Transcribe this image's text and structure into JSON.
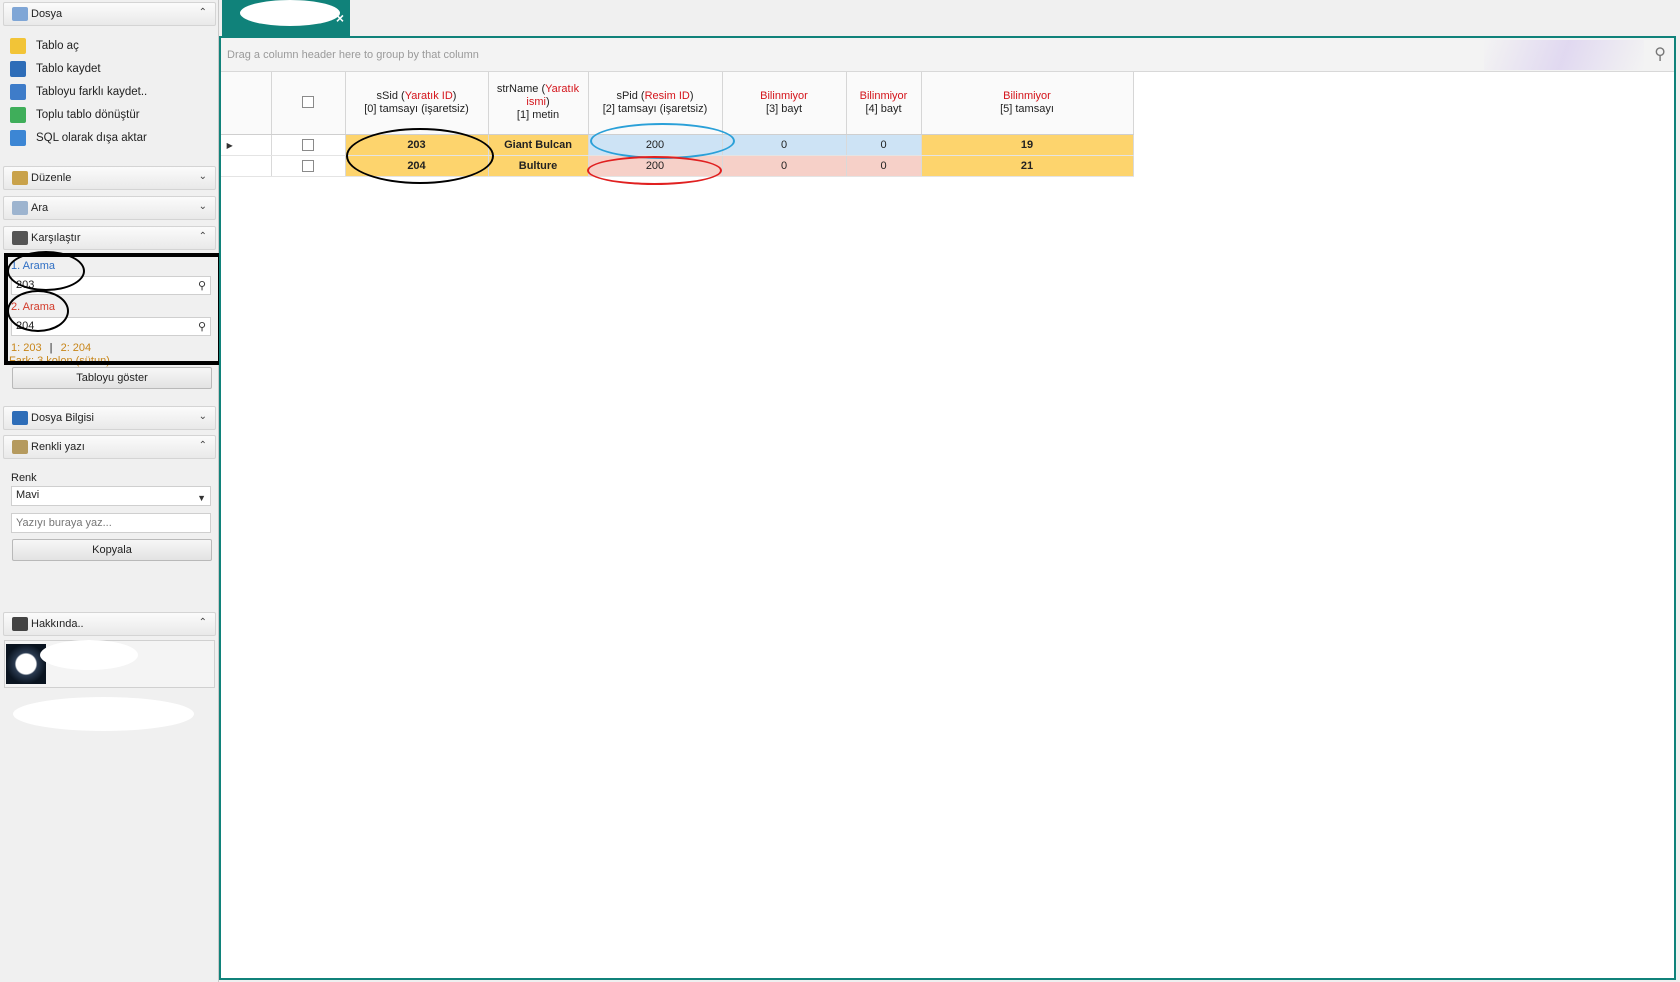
{
  "sidebar": {
    "dosya": {
      "title": "Dosya",
      "items": [
        "Tablo aç",
        "Tablo kaydet",
        "Tabloyu farklı kaydet..",
        "Toplu tablo dönüştür",
        "SQL olarak dışa aktar"
      ]
    },
    "duzenle": "Düzenle",
    "ara": "Ara",
    "karsilastir": {
      "title": "Karşılaştır",
      "search1_label": "1. Arama",
      "search1_value": "203",
      "search2_label": "2. Arama",
      "search2_value": "204",
      "summary1": "1: 203",
      "summary_sep": "|",
      "summary2": "2: 204",
      "diff_text": "Fark: 3 kolon (sütun)",
      "show_button": "Tabloyu göster"
    },
    "dosya_bilgisi": "Dosya Bilgisi",
    "renkli_yazi": {
      "title": "Renkli yazı",
      "color_label": "Renk",
      "color_value": "Mavi",
      "text_placeholder": "Yazıyı buraya yaz...",
      "copy_button": "Kopyala"
    },
    "hakkinda": "Hakkında.."
  },
  "tab": {
    "close": "×"
  },
  "grid": {
    "group_hint": "Drag a column header here to group by that column",
    "columns": [
      {
        "name": "sSid",
        "paren": "Yaratık ID",
        "line2": "[0] tamsayı (işaretsiz)"
      },
      {
        "name": "strName",
        "paren_a": "Yaratık",
        "paren_b": "ismi",
        "line2": "[1] metin"
      },
      {
        "name": "sPid",
        "paren": "Resim ID",
        "line2": "[2] tamsayı (işaretsiz)"
      },
      {
        "red": "Bilinmiyor",
        "line2": "[3] bayt"
      },
      {
        "red": "Bilinmiyor",
        "line2": "[4] bayt"
      },
      {
        "red": "Bilinmiyor",
        "line2": "[5] tamsayı"
      }
    ],
    "rows": [
      {
        "sSid": "203",
        "strName": "Giant Bulcan",
        "sPid": "200",
        "c3": "0",
        "c4": "0",
        "c5": "19"
      },
      {
        "sSid": "204",
        "strName": "Bulture",
        "sPid": "200",
        "c3": "0",
        "c4": "0",
        "c5": "21"
      }
    ]
  },
  "colors": {
    "accent": "#10827a",
    "highlight_yellow": "#fdd46d",
    "row1_blue": "#cde3f5",
    "row2_pink": "#f6d0c8",
    "red_text": "#d4141b",
    "search1_blue": "#2f6fc4",
    "search2_red": "#d23b2a",
    "summary_orange": "#c8861a"
  }
}
